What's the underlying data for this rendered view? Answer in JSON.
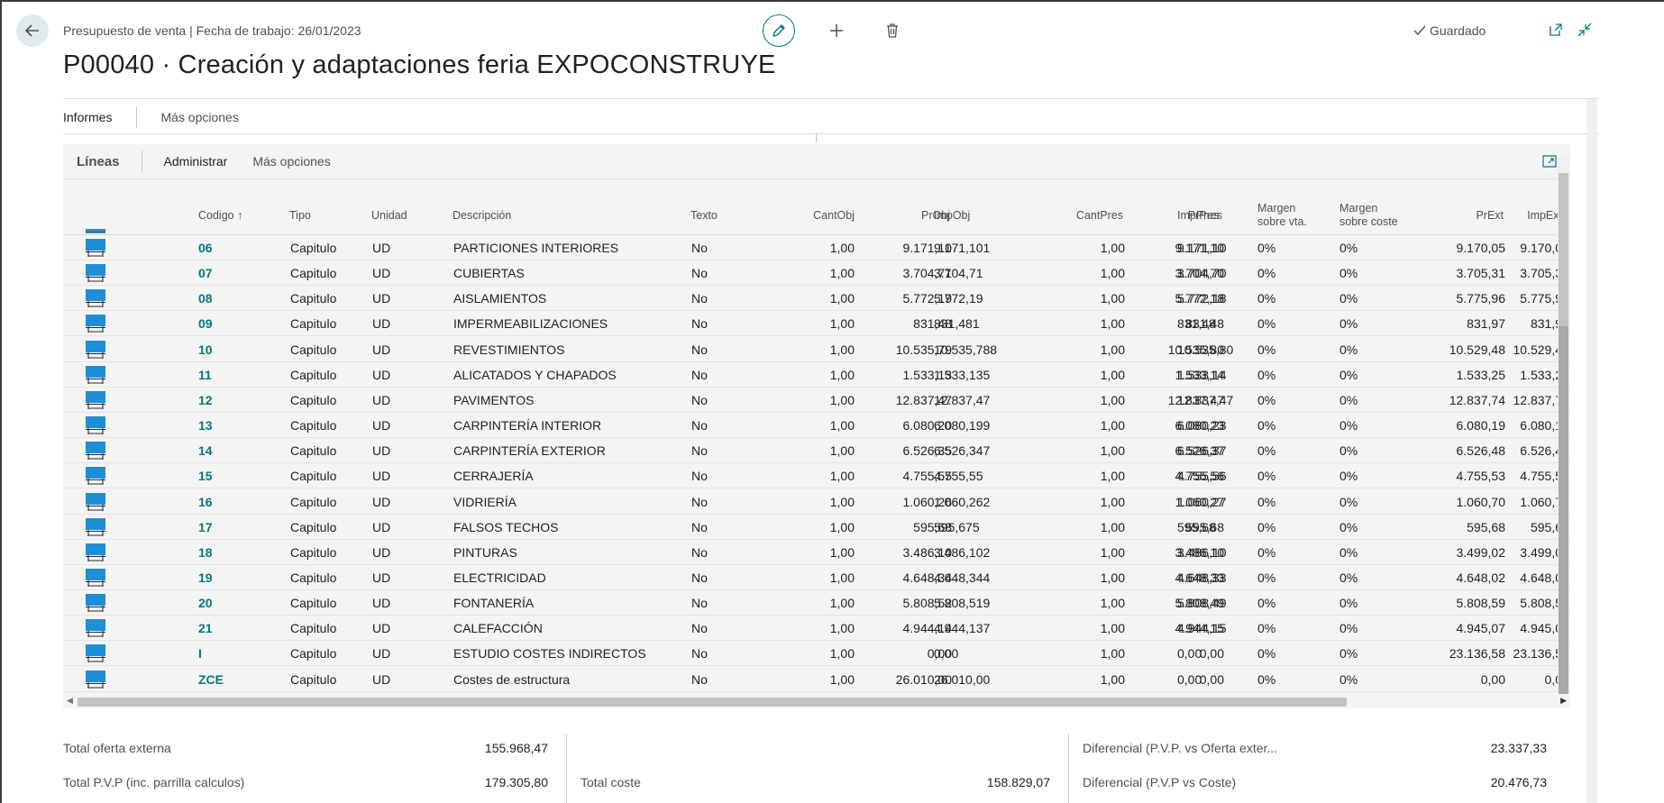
{
  "header": {
    "caption": "Presupuesto de venta | Fecha de trabajo: 26/01/2023",
    "title": "P00040 · Creación y adaptaciones feria EXPOCONSTRUYE",
    "saved_label": "Guardado"
  },
  "actions": {
    "reports": "Informes",
    "more_options": "Más opciones"
  },
  "lines": {
    "title": "Líneas",
    "manage": "Administrar",
    "more_options": "Más opciones",
    "columns": [
      {
        "key": "code",
        "label": "Codigo ↑"
      },
      {
        "key": "type",
        "label": "Tipo"
      },
      {
        "key": "unit",
        "label": "Unidad"
      },
      {
        "key": "desc",
        "label": "Descripción"
      },
      {
        "key": "text",
        "label": "Texto"
      },
      {
        "key": "cantobj",
        "label": "CantObj"
      },
      {
        "key": "probj",
        "label": "PrObj"
      },
      {
        "key": "impobj",
        "label": "ImpObj"
      },
      {
        "key": "cantpres",
        "label": "CantPres"
      },
      {
        "key": "prpres",
        "label": "PrPres"
      },
      {
        "key": "imppres",
        "label": "ImpPres"
      },
      {
        "key": "mvta",
        "label": "Margen sobre vta."
      },
      {
        "key": "mcoste",
        "label": "Margen sobre coste"
      },
      {
        "key": "prext",
        "label": "PrExt"
      },
      {
        "key": "impext",
        "label": "ImpExt"
      }
    ],
    "rows": [
      {
        "code": "06",
        "type": "Capitulo",
        "unit": "UD",
        "desc": "PARTICIONES INTERIORES",
        "text": "No",
        "cantobj": "1,00",
        "probj": "9.171,10",
        "impobj": "9.171,101",
        "cantpres": "1,00",
        "prpres": "9.171,10",
        "imppres": "9.171,10",
        "mvta": "0%",
        "mcoste": "0%",
        "prext": "9.170,05",
        "impext": "9.170,0"
      },
      {
        "code": "07",
        "type": "Capitulo",
        "unit": "UD",
        "desc": "CUBIERTAS",
        "text": "No",
        "cantobj": "1,00",
        "probj": "3.704,71",
        "impobj": "3.704,71",
        "cantpres": "1,00",
        "prpres": "3.704,70",
        "imppres": "3.704,70",
        "mvta": "0%",
        "mcoste": "0%",
        "prext": "3.705,31",
        "impext": "3.705,3"
      },
      {
        "code": "08",
        "type": "Capitulo",
        "unit": "UD",
        "desc": "AISLAMIENTOS",
        "text": "No",
        "cantobj": "1,00",
        "probj": "5.772,19",
        "impobj": "5.772,19",
        "cantpres": "1,00",
        "prpres": "5.772,18",
        "imppres": "5.772,18",
        "mvta": "0%",
        "mcoste": "0%",
        "prext": "5.775,96",
        "impext": "5.775,9"
      },
      {
        "code": "09",
        "type": "Capitulo",
        "unit": "UD",
        "desc": "IMPERMEABILIZACIONES",
        "text": "No",
        "cantobj": "1,00",
        "probj": "831,48",
        "impobj": "831,481",
        "cantpres": "1,00",
        "prpres": "831,48",
        "imppres": "831,48",
        "mvta": "0%",
        "mcoste": "0%",
        "prext": "831,97",
        "impext": "831,9"
      },
      {
        "code": "10",
        "type": "Capitulo",
        "unit": "UD",
        "desc": "REVESTIMIENTOS",
        "text": "No",
        "cantobj": "1,00",
        "probj": "10.535,79",
        "impobj": "10.535,788",
        "cantpres": "1,00",
        "prpres": "10.535,80",
        "imppres": "10.535,80",
        "mvta": "0%",
        "mcoste": "0%",
        "prext": "10.529,48",
        "impext": "10.529,4"
      },
      {
        "code": "11",
        "type": "Capitulo",
        "unit": "UD",
        "desc": "ALICATADOS Y CHAPADOS",
        "text": "No",
        "cantobj": "1,00",
        "probj": "1.533,13",
        "impobj": "1.533,135",
        "cantpres": "1,00",
        "prpres": "1.533,14",
        "imppres": "1.533,14",
        "mvta": "0%",
        "mcoste": "0%",
        "prext": "1.533,25",
        "impext": "1.533,2"
      },
      {
        "code": "12",
        "type": "Capitulo",
        "unit": "UD",
        "desc": "PAVIMENTOS",
        "text": "No",
        "cantobj": "1,00",
        "probj": "12.837,47",
        "impobj": "12.837,47",
        "cantpres": "1,00",
        "prpres": "12.837,47",
        "imppres": "12.837,47",
        "mvta": "0%",
        "mcoste": "0%",
        "prext": "12.837,74",
        "impext": "12.837,7"
      },
      {
        "code": "13",
        "type": "Capitulo",
        "unit": "UD",
        "desc": "CARPINTERÍA INTERIOR",
        "text": "No",
        "cantobj": "1,00",
        "probj": "6.080,20",
        "impobj": "6.080,199",
        "cantpres": "1,00",
        "prpres": "6.080,23",
        "imppres": "6.080,23",
        "mvta": "0%",
        "mcoste": "0%",
        "prext": "6.080,19",
        "impext": "6.080,1"
      },
      {
        "code": "14",
        "type": "Capitulo",
        "unit": "UD",
        "desc": "CARPINTERÍA EXTERIOR",
        "text": "No",
        "cantobj": "1,00",
        "probj": "6.526,35",
        "impobj": "6.526,347",
        "cantpres": "1,00",
        "prpres": "6.526,37",
        "imppres": "6.526,37",
        "mvta": "0%",
        "mcoste": "0%",
        "prext": "6.526,48",
        "impext": "6.526,4"
      },
      {
        "code": "15",
        "type": "Capitulo",
        "unit": "UD",
        "desc": "CERRAJERÍA",
        "text": "No",
        "cantobj": "1,00",
        "probj": "4.755,55",
        "impobj": "4.755,55",
        "cantpres": "1,00",
        "prpres": "4.755,56",
        "imppres": "4.755,56",
        "mvta": "0%",
        "mcoste": "0%",
        "prext": "4.755,53",
        "impext": "4.755,5"
      },
      {
        "code": "16",
        "type": "Capitulo",
        "unit": "UD",
        "desc": "VIDRIERÍA",
        "text": "No",
        "cantobj": "1,00",
        "probj": "1.060,26",
        "impobj": "1.060,262",
        "cantpres": "1,00",
        "prpres": "1.060,27",
        "imppres": "1.060,27",
        "mvta": "0%",
        "mcoste": "0%",
        "prext": "1.060,70",
        "impext": "1.060,7"
      },
      {
        "code": "17",
        "type": "Capitulo",
        "unit": "UD",
        "desc": "FALSOS TECHOS",
        "text": "No",
        "cantobj": "1,00",
        "probj": "595,68",
        "impobj": "595,675",
        "cantpres": "1,00",
        "prpres": "595,68",
        "imppres": "595,68",
        "mvta": "0%",
        "mcoste": "0%",
        "prext": "595,68",
        "impext": "595,6"
      },
      {
        "code": "18",
        "type": "Capitulo",
        "unit": "UD",
        "desc": "PINTURAS",
        "text": "No",
        "cantobj": "1,00",
        "probj": "3.486,10",
        "impobj": "3.486,102",
        "cantpres": "1,00",
        "prpres": "3.486,10",
        "imppres": "3.486,10",
        "mvta": "0%",
        "mcoste": "0%",
        "prext": "3.499,02",
        "impext": "3.499,0"
      },
      {
        "code": "19",
        "type": "Capitulo",
        "unit": "UD",
        "desc": "ELECTRICIDAD",
        "text": "No",
        "cantobj": "1,00",
        "probj": "4.648,34",
        "impobj": "4.648,344",
        "cantpres": "1,00",
        "prpres": "4.648,33",
        "imppres": "4.648,33",
        "mvta": "0%",
        "mcoste": "0%",
        "prext": "4.648,02",
        "impext": "4.648,0"
      },
      {
        "code": "20",
        "type": "Capitulo",
        "unit": "UD",
        "desc": "FONTANERÍA",
        "text": "No",
        "cantobj": "1,00",
        "probj": "5.808,52",
        "impobj": "5.808,519",
        "cantpres": "1,00",
        "prpres": "5.808,49",
        "imppres": "5.808,49",
        "mvta": "0%",
        "mcoste": "0%",
        "prext": "5.808,59",
        "impext": "5.808,5"
      },
      {
        "code": "21",
        "type": "Capitulo",
        "unit": "UD",
        "desc": "CALEFACCIÓN",
        "text": "No",
        "cantobj": "1,00",
        "probj": "4.944,14",
        "impobj": "4.944,137",
        "cantpres": "1,00",
        "prpres": "4.944,15",
        "imppres": "4.944,15",
        "mvta": "0%",
        "mcoste": "0%",
        "prext": "4.945,07",
        "impext": "4.945,0"
      },
      {
        "code": "I",
        "type": "Capitulo",
        "unit": "UD",
        "desc": "ESTUDIO COSTES INDIRECTOS",
        "text": "No",
        "cantobj": "1,00",
        "probj": "0,00",
        "impobj": "0,00",
        "cantpres": "1,00",
        "prpres": "0,00",
        "imppres": "0,00",
        "mvta": "0%",
        "mcoste": "0%",
        "prext": "23.136,58",
        "impext": "23.136,5"
      },
      {
        "code": "ZCE",
        "type": "Capitulo",
        "unit": "UD",
        "desc": "Costes de estructura",
        "text": "No",
        "cantobj": "1,00",
        "probj": "26.010,00",
        "impobj": "26.010,00",
        "cantpres": "1,00",
        "prpres": "0,00",
        "imppres": "0,00",
        "mvta": "0%",
        "mcoste": "0%",
        "prext": "0,00",
        "impext": "0,0"
      }
    ]
  },
  "totals": {
    "oferta_externa_label": "Total oferta externa",
    "oferta_externa_value": "155.968,47",
    "pvp_label": "Total P.V.P (inc. parrilla calculos)",
    "pvp_value": "179.305,80",
    "coste_label": "Total coste",
    "coste_value": "158.829,07",
    "dif_oferta_label": "Diferencial (P.V.P. vs Oferta exter...",
    "dif_oferta_value": "23.337,33",
    "dif_coste_label": "Diferencial (P.V.P vs Coste)",
    "dif_coste_value": "20.476,73"
  },
  "colors": {
    "accent": "#00797f",
    "row_icon": "#1e8fd6"
  }
}
